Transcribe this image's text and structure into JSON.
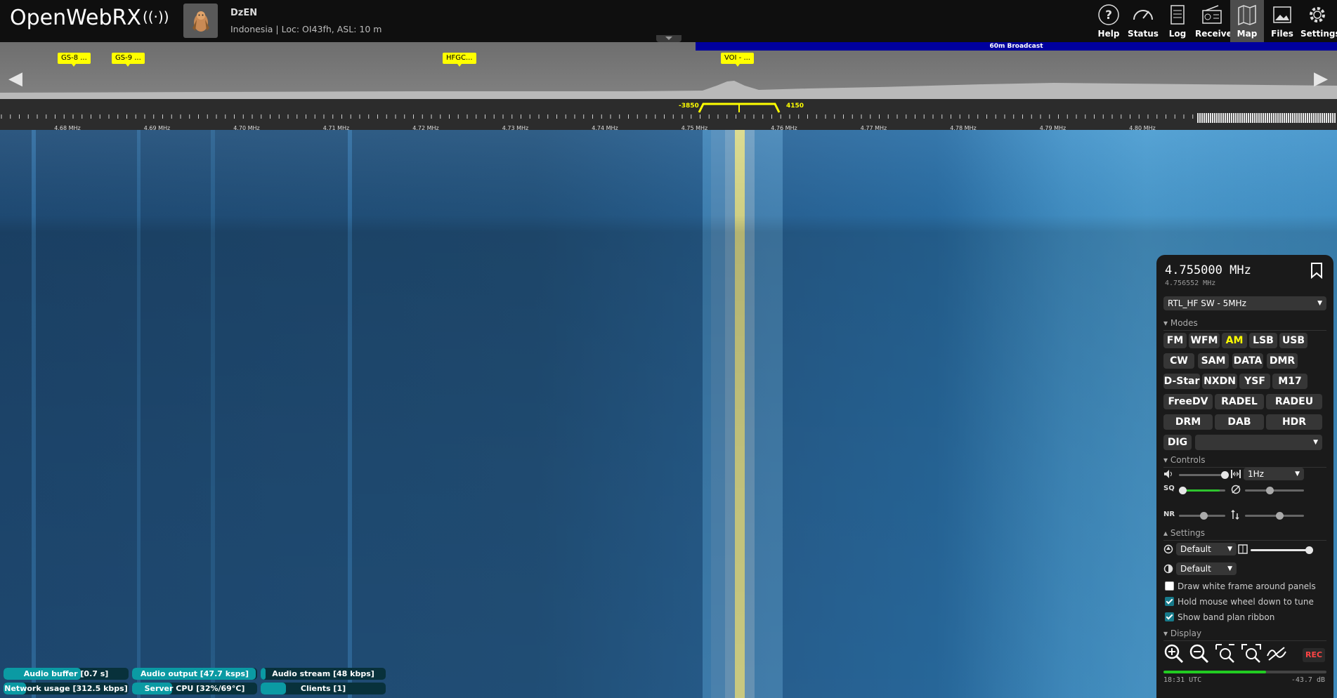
{
  "header": {
    "logo_text": "OpenWebRX",
    "receiver_name": "DzEN",
    "receiver_location": "Indonesia | Loc: OI43fh, ASL: 10 m",
    "buttons": [
      {
        "label": "Help",
        "icon": "help-icon"
      },
      {
        "label": "Status",
        "icon": "gauge-icon"
      },
      {
        "label": "Log",
        "icon": "log-icon"
      },
      {
        "label": "Receiver",
        "icon": "radio-icon"
      },
      {
        "label": "Map",
        "icon": "map-icon"
      },
      {
        "label": "Files",
        "icon": "image-icon"
      },
      {
        "label": "Settings",
        "icon": "gear-icon"
      }
    ],
    "active_button": "Map"
  },
  "spectrum": {
    "band_ribbon": "60m Broadcast",
    "bookmarks": [
      "GS-8 ...",
      "GS-9 ...",
      "HFGC...",
      "VOI - ..."
    ],
    "passband_low": "-3850",
    "passband_high": "4150",
    "scale_labels": [
      "4.68 MHz",
      "4.69 MHz",
      "4.70 MHz",
      "4.71 MHz",
      "4.72 MHz",
      "4.73 MHz",
      "4.74 MHz",
      "4.75 MHz",
      "4.76 MHz",
      "4.77 MHz",
      "4.78 MHz",
      "4.79 MHz",
      "4.80 MHz"
    ]
  },
  "panel": {
    "frequency": "4.755000 MHz",
    "sub_frequency": "4.756552 MHz",
    "profile": "RTL_HF SW - 5MHz",
    "modes_title": "Modes",
    "modes_row1": [
      "FM",
      "WFM",
      "AM",
      "LSB",
      "USB"
    ],
    "modes_row2": [
      "CW",
      "SAM",
      "DATA",
      "DMR"
    ],
    "modes_row3": [
      "D-Star",
      "NXDN",
      "YSF",
      "M17"
    ],
    "modes_row4": [
      "FreeDV",
      "RADEL",
      "RADEU"
    ],
    "modes_row5": [
      "DRM",
      "DAB",
      "HDR"
    ],
    "dig_label": "DIG",
    "selected_mode": "AM",
    "controls_title": "Controls",
    "step_value": "1Hz",
    "volume_level": 0.82,
    "squelch_level": 0.0,
    "nr_level": 0.5,
    "settings_title": "Settings",
    "theme_value": "Default",
    "colormap_value": "Default",
    "checkboxes": [
      {
        "label": "Draw white frame around panels",
        "checked": false
      },
      {
        "label": "Hold mouse wheel down to tune",
        "checked": true
      },
      {
        "label": "Show band plan ribbon",
        "checked": true
      }
    ],
    "display_title": "Display",
    "rec_label": "REC",
    "time": "18:31 UTC",
    "level": "-43.7 dB",
    "level_fraction": 0.63
  },
  "status": {
    "bars": [
      {
        "label": "Audio buffer [0.7 s]",
        "fill": 0.62
      },
      {
        "label": "Audio output [47.7 ksps]",
        "fill": 0.99
      },
      {
        "label": "Audio stream [48 kbps]",
        "fill": 0.04
      },
      {
        "label": "Network usage [312.5 kbps]",
        "fill": 0.18
      },
      {
        "label": "Server CPU [32%/69°C]",
        "fill": 0.32
      },
      {
        "label": "Clients [1]",
        "fill": 0.2
      }
    ]
  },
  "colors": {
    "accent": "#ffff00",
    "band_ribbon": "#00009e",
    "status_fill": "#0b9aa3",
    "rec": "#ff4444"
  }
}
